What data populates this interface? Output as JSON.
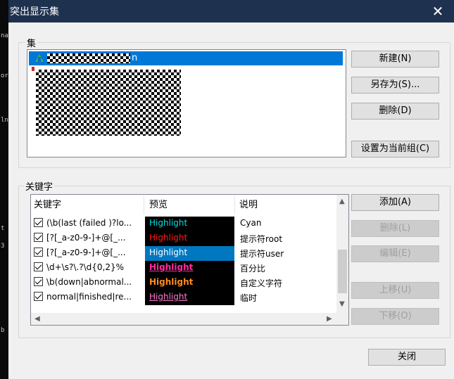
{
  "window": {
    "title": "突出显示集",
    "close_glyph": "✕"
  },
  "sets_group": {
    "label": "集",
    "selected_item_suffix": "n"
  },
  "set_buttons": {
    "new": "新建(N)",
    "save_as": "另存为(S)...",
    "delete": "删除(D)",
    "set_current": "设置为当前组(C)"
  },
  "keywords_group": {
    "label": "关键字"
  },
  "columns": {
    "keyword": "关键字",
    "preview": "预览",
    "description": "说明"
  },
  "rows": [
    {
      "keyword": "(\\b(last (failed )?lo...",
      "preview": "Highlight",
      "preview_color": "#00e0e0",
      "preview_bg": "#000000",
      "bold": false,
      "underline": false,
      "description": "Cyan"
    },
    {
      "keyword": "[?[_a-z0-9-]+@[_...",
      "preview": "Highlight",
      "preview_color": "#ff1a1a",
      "preview_bg": "#000000",
      "bold": false,
      "underline": false,
      "description": "提示符root"
    },
    {
      "keyword": "[?[_a-z0-9-]+@[_...",
      "preview": "Highlight",
      "preview_color": "#ffffff",
      "preview_bg": "#0078c0",
      "bold": false,
      "underline": false,
      "description": "提示符user"
    },
    {
      "keyword": "\\d+\\s?\\.?\\d{0,2}%",
      "preview": "Highlight",
      "preview_color": "#ff2aa0",
      "preview_bg": "#000000",
      "bold": true,
      "underline": true,
      "description": "百分比"
    },
    {
      "keyword": "\\b(down|abnormal...",
      "preview": "Highlight",
      "preview_color": "#ff8c1a",
      "preview_bg": "#000000",
      "bold": true,
      "underline": false,
      "description": "自定义字符"
    },
    {
      "keyword": "normal|finished|re...",
      "preview": "Highlight",
      "preview_color": "#ff7ad0",
      "preview_bg": "#000000",
      "bold": false,
      "underline": true,
      "description": "临时"
    }
  ],
  "keyword_buttons": {
    "add": "添加(A)",
    "delete": "删除(L)",
    "edit": "编辑(E)",
    "move_up": "上移(U)",
    "move_down": "下移(O)"
  },
  "footer": {
    "close": "关闭"
  },
  "background_fragments": [
    "na",
    "or",
    "ln",
    "t",
    "3",
    "b"
  ]
}
